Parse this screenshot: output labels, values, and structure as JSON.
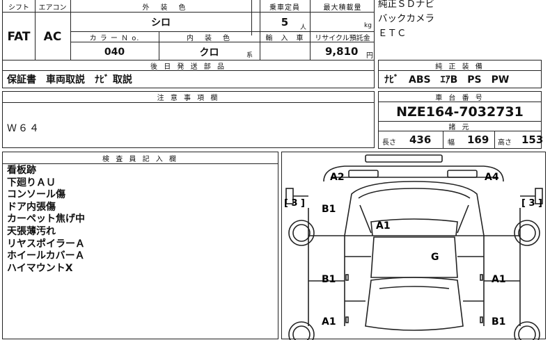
{
  "header": {
    "shift_label": "シフト",
    "aircon_label": "エアコン",
    "shift_value": "FAT",
    "aircon_value": "AC",
    "exterior_color_label": "外　装　色",
    "exterior_color_value": "シロ",
    "capacity_label": "乗車定員",
    "capacity_value": "5",
    "capacity_unit": "人",
    "max_load_label": "最大積載量",
    "max_load_unit": "kg",
    "color_no_label": "カ ラ ー Ｎ o.",
    "color_no_value": "040",
    "interior_color_label": "内　装　色",
    "interior_color_value": "クロ",
    "interior_color_suffix": "系",
    "import_label": "輸　入　車",
    "recycle_label": "リサイクル預託金",
    "recycle_value": "9,810",
    "recycle_unit": "円"
  },
  "options_top": [
    "純正ＳＤナビ",
    "バックカメラ",
    "ＥＴＣ"
  ],
  "later_parts": {
    "label": "後 日 発 送 部 品",
    "value": "保証書　車両取説　ﾅﾋﾞ 取説"
  },
  "factory_equipment": {
    "label": "純 正 装 備",
    "value": "ﾅﾋﾞ　ABS　ｴｱB　PS　PW"
  },
  "notes": {
    "label": "注 意 事 項 欄",
    "value": "Ｗ６４"
  },
  "chassis": {
    "label": "車 台 番 号",
    "value": "NZE164-7032731"
  },
  "specs": {
    "label": "諸 元",
    "length_label": "長さ",
    "length_value": "436",
    "width_label": "幅",
    "width_value": "169",
    "height_label": "高さ",
    "height_value": "153"
  },
  "inspector": {
    "label": "検 査 員 記 入 欄",
    "remarks": [
      "看板跡",
      "下廻りＡＵ",
      "コンソール傷",
      "ドア内張傷",
      "カーペット焦げ中",
      "天張薄汚れ",
      "リヤスポイラーＡ",
      "ホイールカバーＡ",
      "ハイマウントX"
    ]
  },
  "diagram": {
    "left_bracket": "[ 3 ]",
    "right_bracket": "[ 3 ]",
    "marks": [
      "A2",
      "A4",
      "B1",
      "A1",
      "G",
      "B1",
      "A1",
      "A1",
      "B1"
    ]
  }
}
